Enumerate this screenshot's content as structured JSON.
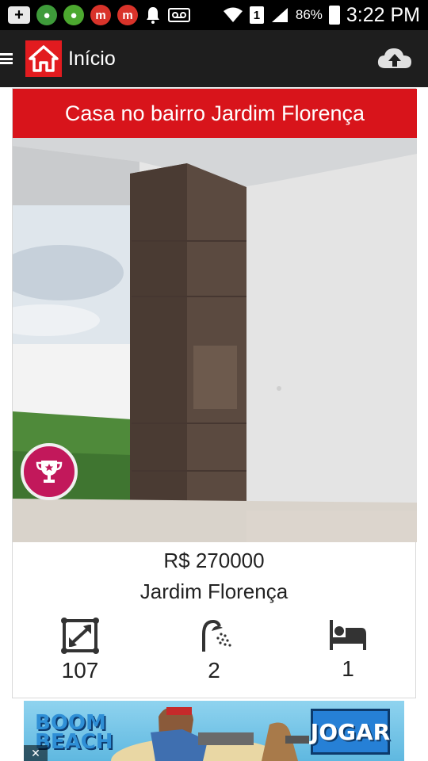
{
  "status_bar": {
    "battery": "86%",
    "time": "3:22 PM",
    "sim_slot": "1",
    "icons": [
      "add-icon",
      "game-icon",
      "game-icon",
      "app-m-icon",
      "app-m-icon",
      "bell-icon",
      "voicemail-icon",
      "wifi-icon",
      "signal-icon",
      "battery-icon"
    ]
  },
  "app_bar": {
    "title": "Início",
    "icons": [
      "menu-icon",
      "home-icon",
      "cloud-upload-icon"
    ]
  },
  "listing": {
    "title": "Casa no bairro Jardim Florença",
    "price": "R$ 270000",
    "neighborhood": "Jardim Florença",
    "features": [
      {
        "icon": "area-icon",
        "value": "107"
      },
      {
        "icon": "shower-icon",
        "value": "2"
      },
      {
        "icon": "bed-icon",
        "value": "1"
      }
    ],
    "badge_icon": "trophy-icon"
  },
  "ad": {
    "logo_text_1": "BOOM",
    "logo_text_2": "BEACH",
    "cta": "JOGAR",
    "close": "✕"
  },
  "colors": {
    "accent_red": "#d8141b",
    "app_bar_bg": "#1e1e1e",
    "badge_pink": "#c2185b"
  }
}
